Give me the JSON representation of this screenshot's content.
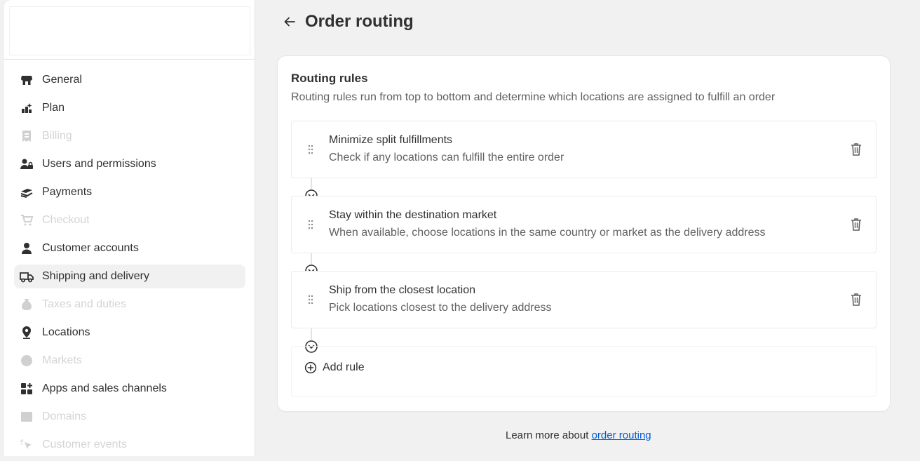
{
  "sidebar": {
    "items": [
      {
        "label": "General",
        "icon": "store-icon",
        "state": "normal"
      },
      {
        "label": "Plan",
        "icon": "plan-icon",
        "state": "normal"
      },
      {
        "label": "Billing",
        "icon": "billing-icon",
        "state": "disabled"
      },
      {
        "label": "Users and permissions",
        "icon": "users-icon",
        "state": "normal"
      },
      {
        "label": "Payments",
        "icon": "payments-icon",
        "state": "normal"
      },
      {
        "label": "Checkout",
        "icon": "cart-icon",
        "state": "disabled"
      },
      {
        "label": "Customer accounts",
        "icon": "person-icon",
        "state": "normal"
      },
      {
        "label": "Shipping and delivery",
        "icon": "truck-icon",
        "state": "active"
      },
      {
        "label": "Taxes and duties",
        "icon": "tax-icon",
        "state": "disabled"
      },
      {
        "label": "Locations",
        "icon": "location-pin-icon",
        "state": "normal"
      },
      {
        "label": "Markets",
        "icon": "globe-icon",
        "state": "disabled"
      },
      {
        "label": "Apps and sales channels",
        "icon": "apps-icon",
        "state": "normal"
      },
      {
        "label": "Domains",
        "icon": "domain-icon",
        "state": "disabled"
      },
      {
        "label": "Customer events",
        "icon": "cursor-icon",
        "state": "disabled"
      }
    ]
  },
  "header": {
    "title": "Order routing",
    "back_icon": "arrow-left-icon"
  },
  "card": {
    "title": "Routing rules",
    "description": "Routing rules run from top to bottom and determine which locations are assigned to fulfill an order",
    "rules": [
      {
        "title": "Minimize split fulfillments",
        "description": "Check if any locations can fulfill the entire order"
      },
      {
        "title": "Stay within the destination market",
        "description": "When available, choose locations in the same country or market as the delivery address"
      },
      {
        "title": "Ship from the closest location",
        "description": "Pick locations closest to the delivery address"
      }
    ],
    "add_rule_label": "Add rule"
  },
  "footer": {
    "prefix": "Learn more about",
    "link": "order routing"
  },
  "colors": {
    "background": "#f1f1f1",
    "link": "#005bd3",
    "text": "#303030",
    "muted": "#616161"
  }
}
